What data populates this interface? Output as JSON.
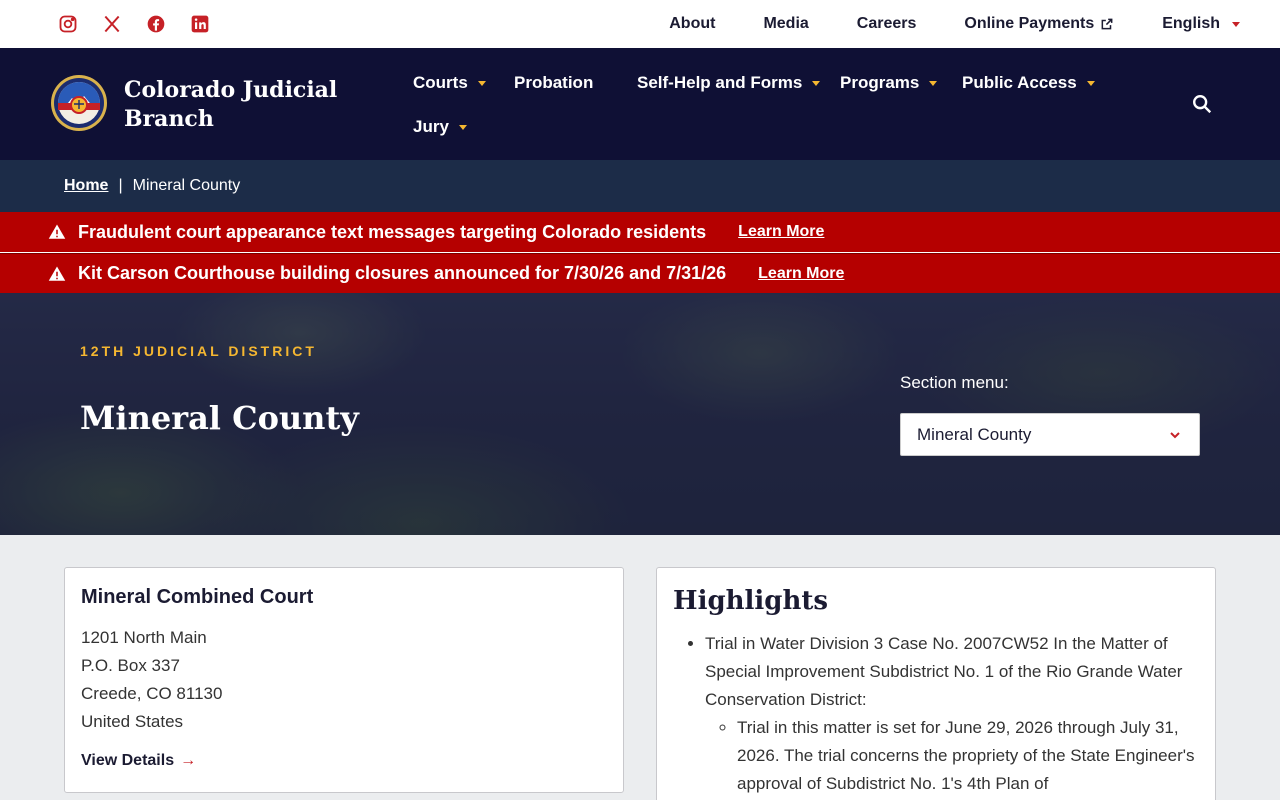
{
  "utility": {
    "social": [
      "instagram-icon",
      "x-icon",
      "facebook-icon",
      "linkedin-icon"
    ],
    "links": {
      "about": "About",
      "media": "Media",
      "careers": "Careers",
      "payments": "Online Payments",
      "language": "English"
    }
  },
  "brand": {
    "name": "Colorado Judicial Branch"
  },
  "nav": {
    "courts": "Courts",
    "probation": "Probation",
    "selfhelp": "Self-Help and Forms",
    "programs": "Programs",
    "public": "Public Access",
    "jury": "Jury"
  },
  "breadcrumb": {
    "home": "Home",
    "current": "Mineral County"
  },
  "alerts": [
    {
      "message": "Fraudulent court appearance text messages targeting Colorado residents",
      "link": "Learn More"
    },
    {
      "message": "Kit Carson Courthouse building closures announced for 7/30/26 and 7/31/26",
      "link": "Learn More"
    }
  ],
  "hero": {
    "eyebrow": "12TH JUDICIAL DISTRICT",
    "title": "Mineral County",
    "section_label": "Section menu:",
    "section_value": "Mineral County"
  },
  "court": {
    "name": "Mineral Combined Court",
    "address": [
      "1201 North Main",
      "P.O. Box 337",
      "Creede, CO 81130",
      "United States"
    ],
    "details": "View Details"
  },
  "highlights": {
    "title": "Highlights",
    "item": "Trial in Water Division 3 Case No. 2007CW52 In the Matter of Special Improvement Subdistrict No. 1 of the Rio Grande Water Conservation District:",
    "sub": "Trial in this matter is set for June 29, 2026 through July 31, 2026. The trial concerns the propriety of the State Engineer's approval of Subdistrict No. 1's 4th Plan of"
  },
  "colors": {
    "navy": "#0f1035",
    "crumb": "#1c2c48",
    "alert": "#b50000",
    "accent_red": "#c62127",
    "accent_gold": "#f5b731"
  }
}
